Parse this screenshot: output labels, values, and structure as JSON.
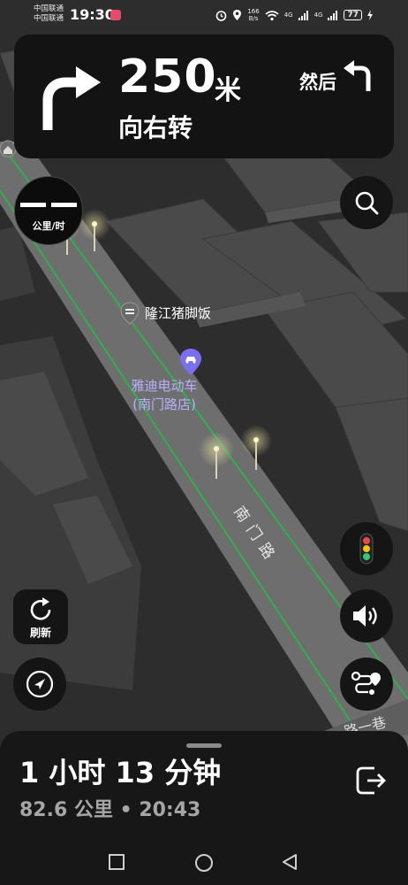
{
  "status_bar": {
    "carrier_1": "中国联通",
    "carrier_2": "中国联通",
    "time": "19:30",
    "net_speed_value": "166",
    "net_speed_unit": "B/s",
    "signal_1": "4G",
    "signal_2": "4G",
    "battery": "77"
  },
  "nav_card": {
    "distance": "250",
    "distance_unit": "米",
    "instruction": "向右转",
    "then_label": "然后"
  },
  "speed": {
    "unit": "公里/时"
  },
  "map": {
    "poi_restaurant": "隆江猪脚饭",
    "poi_shop_line1": "雅迪电动车",
    "poi_shop_line2": "(南门路店)",
    "road_name": "南门路",
    "road_name_2": "路一巷"
  },
  "controls": {
    "refresh_label": "刷新"
  },
  "trip": {
    "duration": "1 小时 13 分钟",
    "detail": "82.6 公里 • 20:43"
  },
  "colors": {
    "route_green": "#2fb14a",
    "poi_purple": "#7b6ef0",
    "streetlight": "#f5e6a0"
  }
}
